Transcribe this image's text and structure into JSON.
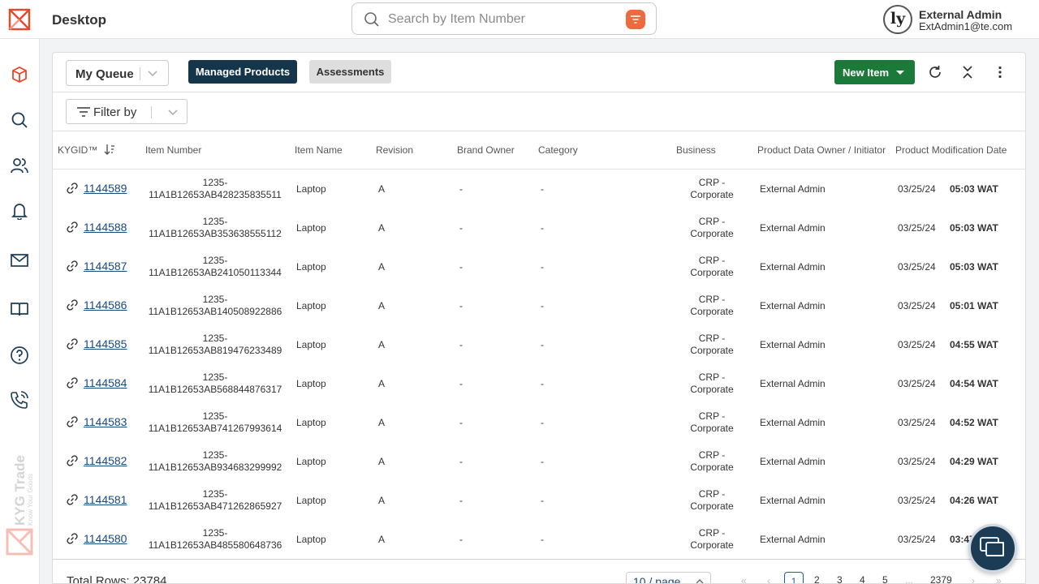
{
  "header": {
    "app_title": "Desktop",
    "search_placeholder": "Search by Item Number",
    "user_name": "External Admin",
    "user_email": "ExtAdmin1@te.com",
    "avatar_text": "ly"
  },
  "sidebar": {
    "items": [
      "products-icon",
      "search-icon",
      "users-icon",
      "bell-icon",
      "mail-icon",
      "book-icon",
      "help-icon",
      "phone-icon"
    ],
    "brand_name": "KYG Trade",
    "brand_tagline": "Know Your Goods"
  },
  "toolbar": {
    "queue_label": "My Queue",
    "tab_managed": "Managed Products",
    "tab_assessments": "Assessments",
    "new_item_label": "New Item",
    "filter_label": "Filter by"
  },
  "table": {
    "columns": [
      "KYGID™",
      "Item Number",
      "Item Name",
      "Revision",
      "Brand Owner",
      "Category",
      "Business",
      "Product Data Owner / Initiator",
      "Product Modification Date"
    ],
    "rows": [
      {
        "id": "1144589",
        "item_prefix": "1235-",
        "item_suffix": "11A1B12653AB428235835511",
        "name": "Laptop",
        "rev": "A",
        "brand": "-",
        "category": "-",
        "business_1": "CRP -",
        "business_2": "Corporate",
        "owner": "External Admin",
        "date": "03/25/24",
        "time": "05:03 WAT"
      },
      {
        "id": "1144588",
        "item_prefix": "1235-",
        "item_suffix": "11A1B12653AB353638555112",
        "name": "Laptop",
        "rev": "A",
        "brand": "-",
        "category": "-",
        "business_1": "CRP -",
        "business_2": "Corporate",
        "owner": "External Admin",
        "date": "03/25/24",
        "time": "05:03 WAT"
      },
      {
        "id": "1144587",
        "item_prefix": "1235-",
        "item_suffix": "11A1B12653AB241050113344",
        "name": "Laptop",
        "rev": "A",
        "brand": "-",
        "category": "-",
        "business_1": "CRP -",
        "business_2": "Corporate",
        "owner": "External Admin",
        "date": "03/25/24",
        "time": "05:03 WAT"
      },
      {
        "id": "1144586",
        "item_prefix": "1235-",
        "item_suffix": "11A1B12653AB140508922886",
        "name": "Laptop",
        "rev": "A",
        "brand": "-",
        "category": "-",
        "business_1": "CRP -",
        "business_2": "Corporate",
        "owner": "External Admin",
        "date": "03/25/24",
        "time": "05:01 WAT"
      },
      {
        "id": "1144585",
        "item_prefix": "1235-",
        "item_suffix": "11A1B12653AB819476233489",
        "name": "Laptop",
        "rev": "A",
        "brand": "-",
        "category": "-",
        "business_1": "CRP -",
        "business_2": "Corporate",
        "owner": "External Admin",
        "date": "03/25/24",
        "time": "04:55 WAT"
      },
      {
        "id": "1144584",
        "item_prefix": "1235-",
        "item_suffix": "11A1B12653AB568844876317",
        "name": "Laptop",
        "rev": "A",
        "brand": "-",
        "category": "-",
        "business_1": "CRP -",
        "business_2": "Corporate",
        "owner": "External Admin",
        "date": "03/25/24",
        "time": "04:54 WAT"
      },
      {
        "id": "1144583",
        "item_prefix": "1235-",
        "item_suffix": "11A1B12653AB741267993614",
        "name": "Laptop",
        "rev": "A",
        "brand": "-",
        "category": "-",
        "business_1": "CRP -",
        "business_2": "Corporate",
        "owner": "External Admin",
        "date": "03/25/24",
        "time": "04:52 WAT"
      },
      {
        "id": "1144582",
        "item_prefix": "1235-",
        "item_suffix": "11A1B12653AB934683299992",
        "name": "Laptop",
        "rev": "A",
        "brand": "-",
        "category": "-",
        "business_1": "CRP -",
        "business_2": "Corporate",
        "owner": "External Admin",
        "date": "03/25/24",
        "time": "04:29 WAT"
      },
      {
        "id": "1144581",
        "item_prefix": "1235-",
        "item_suffix": "11A1B12653AB471262865927",
        "name": "Laptop",
        "rev": "A",
        "brand": "-",
        "category": "-",
        "business_1": "CRP -",
        "business_2": "Corporate",
        "owner": "External Admin",
        "date": "03/25/24",
        "time": "04:26 WAT"
      },
      {
        "id": "1144580",
        "item_prefix": "1235-",
        "item_suffix": "11A1B12653AB485580648736",
        "name": "Laptop",
        "rev": "A",
        "brand": "-",
        "category": "-",
        "business_1": "CRP -",
        "business_2": "Corporate",
        "owner": "External Admin",
        "date": "03/25/24",
        "time": "03:47"
      }
    ]
  },
  "pagination": {
    "total_rows": "Total Rows: 23784",
    "page_size": "10 / page",
    "pages": [
      "1",
      "2",
      "3",
      "4",
      "5",
      "...",
      "2379"
    ],
    "current_page": "1"
  },
  "colors": {
    "brand": "#f06a3f",
    "primary_dark": "#15354a",
    "success": "#1b7a3a",
    "link": "#1a4a7a"
  }
}
